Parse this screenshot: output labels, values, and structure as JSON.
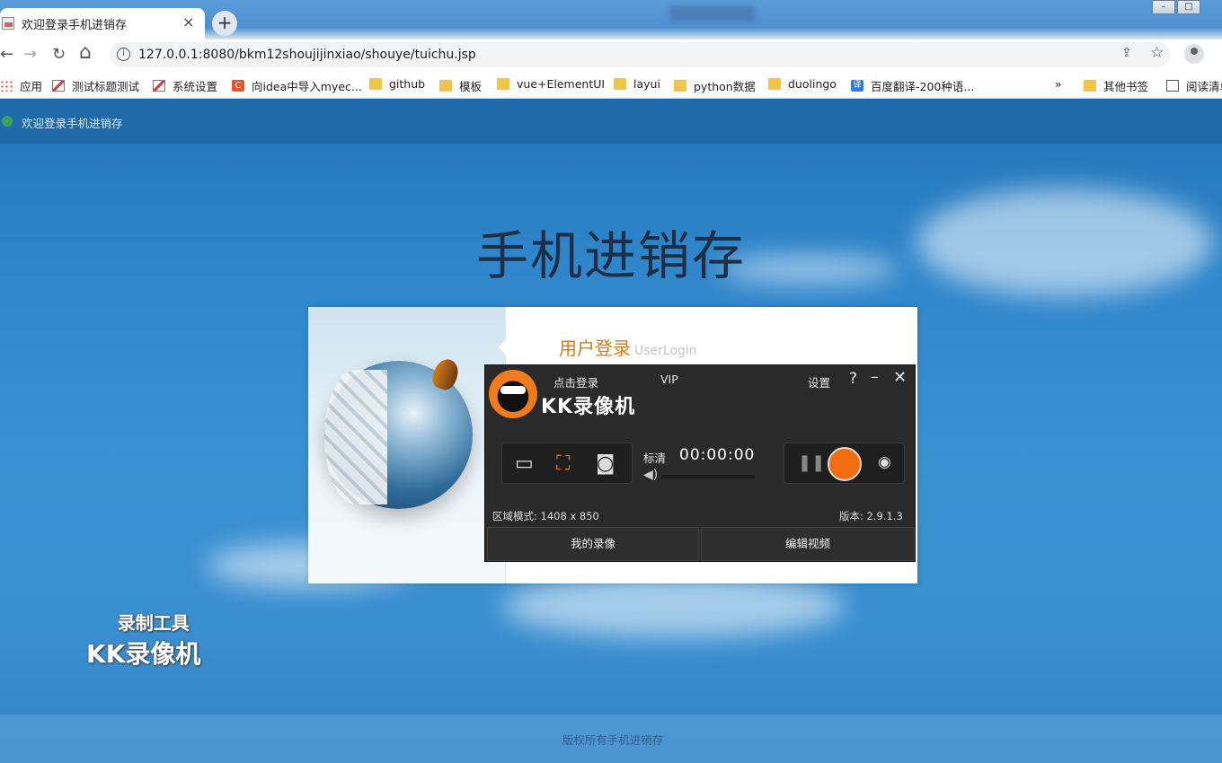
{
  "browser": {
    "tab_title": "欢迎登录手机进销存",
    "tab_close": "×",
    "new_tab": "+",
    "url": "127.0.0.1:8080/bkm12shoujijinxiao/shouye/tuichu.jsp",
    "nav": {
      "back": "←",
      "forward": "→",
      "reload": "↻",
      "home": "⌂"
    },
    "window_controls": {
      "minimize": "–",
      "maximize": "□"
    }
  },
  "bookmarks": [
    {
      "label": "应用",
      "icon": "apps-icon"
    },
    {
      "label": "测试标题测试",
      "icon": "image-icon"
    },
    {
      "label": "系统设置",
      "icon": "image-icon"
    },
    {
      "label": "向idea中导入myec...",
      "icon": "c-icon"
    },
    {
      "label": "github",
      "icon": "folder-icon"
    },
    {
      "label": "模板",
      "icon": "folder-icon"
    },
    {
      "label": "vue+ElementUI",
      "icon": "folder-icon"
    },
    {
      "label": "layui",
      "icon": "folder-icon"
    },
    {
      "label": "python数据",
      "icon": "folder-icon"
    },
    {
      "label": "duolingo",
      "icon": "folder-icon"
    },
    {
      "label": "百度翻译-200种语...",
      "icon": "translate-icon"
    }
  ],
  "bookmarks_overflow": "»",
  "other_bookmarks": "其他书签",
  "reading_list": "阅读清单",
  "page": {
    "welcome": "欢迎登录手机进销存",
    "system_name": "手机进销存",
    "login_title": "用户登录",
    "login_title_en": "UserLogin",
    "footer": "版权所有手机进销存"
  },
  "recorder": {
    "login": "点击登录",
    "vip": "VIP",
    "settings": "设置",
    "help": "?",
    "minimize": "–",
    "close": "✕",
    "brand": "KK录像机",
    "quality": "标清",
    "timer": "00:00:00",
    "area_mode": "区域模式: 1408 x 850",
    "version": "版本: 2.9.1.3",
    "my_recordings": "我的录像",
    "edit_video": "编辑视频"
  },
  "watermark": {
    "line1": "录制工具",
    "line2": "KK录像机"
  },
  "colors": {
    "record_button": "#f26d10",
    "login_title": "#d07c1c",
    "page_bg": "#2f86cb"
  }
}
